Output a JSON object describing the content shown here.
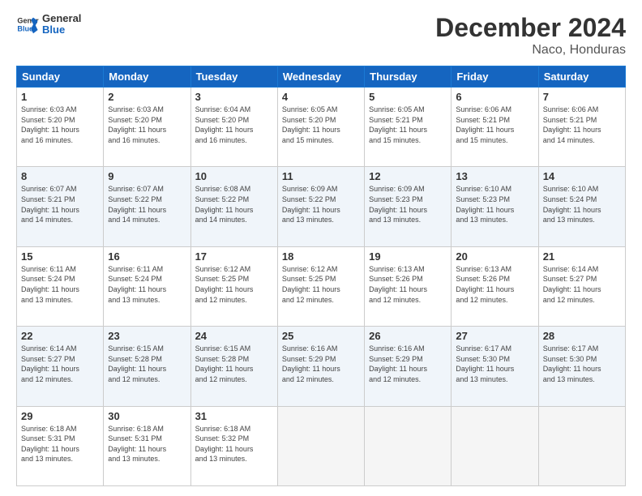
{
  "logo": {
    "line1": "General",
    "line2": "Blue"
  },
  "title": "December 2024",
  "subtitle": "Naco, Honduras",
  "calendar": {
    "headers": [
      "Sunday",
      "Monday",
      "Tuesday",
      "Wednesday",
      "Thursday",
      "Friday",
      "Saturday"
    ],
    "weeks": [
      [
        {
          "day": 1,
          "sunrise": "6:03 AM",
          "sunset": "5:20 PM",
          "daylight": "11 hours and 16 minutes."
        },
        {
          "day": 2,
          "sunrise": "6:03 AM",
          "sunset": "5:20 PM",
          "daylight": "11 hours and 16 minutes."
        },
        {
          "day": 3,
          "sunrise": "6:04 AM",
          "sunset": "5:20 PM",
          "daylight": "11 hours and 16 minutes."
        },
        {
          "day": 4,
          "sunrise": "6:05 AM",
          "sunset": "5:20 PM",
          "daylight": "11 hours and 15 minutes."
        },
        {
          "day": 5,
          "sunrise": "6:05 AM",
          "sunset": "5:21 PM",
          "daylight": "11 hours and 15 minutes."
        },
        {
          "day": 6,
          "sunrise": "6:06 AM",
          "sunset": "5:21 PM",
          "daylight": "11 hours and 15 minutes."
        },
        {
          "day": 7,
          "sunrise": "6:06 AM",
          "sunset": "5:21 PM",
          "daylight": "11 hours and 14 minutes."
        }
      ],
      [
        {
          "day": 8,
          "sunrise": "6:07 AM",
          "sunset": "5:21 PM",
          "daylight": "11 hours and 14 minutes."
        },
        {
          "day": 9,
          "sunrise": "6:07 AM",
          "sunset": "5:22 PM",
          "daylight": "11 hours and 14 minutes."
        },
        {
          "day": 10,
          "sunrise": "6:08 AM",
          "sunset": "5:22 PM",
          "daylight": "11 hours and 14 minutes."
        },
        {
          "day": 11,
          "sunrise": "6:09 AM",
          "sunset": "5:22 PM",
          "daylight": "11 hours and 13 minutes."
        },
        {
          "day": 12,
          "sunrise": "6:09 AM",
          "sunset": "5:23 PM",
          "daylight": "11 hours and 13 minutes."
        },
        {
          "day": 13,
          "sunrise": "6:10 AM",
          "sunset": "5:23 PM",
          "daylight": "11 hours and 13 minutes."
        },
        {
          "day": 14,
          "sunrise": "6:10 AM",
          "sunset": "5:24 PM",
          "daylight": "11 hours and 13 minutes."
        }
      ],
      [
        {
          "day": 15,
          "sunrise": "6:11 AM",
          "sunset": "5:24 PM",
          "daylight": "11 hours and 13 minutes."
        },
        {
          "day": 16,
          "sunrise": "6:11 AM",
          "sunset": "5:24 PM",
          "daylight": "11 hours and 13 minutes."
        },
        {
          "day": 17,
          "sunrise": "6:12 AM",
          "sunset": "5:25 PM",
          "daylight": "11 hours and 12 minutes."
        },
        {
          "day": 18,
          "sunrise": "6:12 AM",
          "sunset": "5:25 PM",
          "daylight": "11 hours and 12 minutes."
        },
        {
          "day": 19,
          "sunrise": "6:13 AM",
          "sunset": "5:26 PM",
          "daylight": "11 hours and 12 minutes."
        },
        {
          "day": 20,
          "sunrise": "6:13 AM",
          "sunset": "5:26 PM",
          "daylight": "11 hours and 12 minutes."
        },
        {
          "day": 21,
          "sunrise": "6:14 AM",
          "sunset": "5:27 PM",
          "daylight": "11 hours and 12 minutes."
        }
      ],
      [
        {
          "day": 22,
          "sunrise": "6:14 AM",
          "sunset": "5:27 PM",
          "daylight": "11 hours and 12 minutes."
        },
        {
          "day": 23,
          "sunrise": "6:15 AM",
          "sunset": "5:28 PM",
          "daylight": "11 hours and 12 minutes."
        },
        {
          "day": 24,
          "sunrise": "6:15 AM",
          "sunset": "5:28 PM",
          "daylight": "11 hours and 12 minutes."
        },
        {
          "day": 25,
          "sunrise": "6:16 AM",
          "sunset": "5:29 PM",
          "daylight": "11 hours and 12 minutes."
        },
        {
          "day": 26,
          "sunrise": "6:16 AM",
          "sunset": "5:29 PM",
          "daylight": "11 hours and 12 minutes."
        },
        {
          "day": 27,
          "sunrise": "6:17 AM",
          "sunset": "5:30 PM",
          "daylight": "11 hours and 13 minutes."
        },
        {
          "day": 28,
          "sunrise": "6:17 AM",
          "sunset": "5:30 PM",
          "daylight": "11 hours and 13 minutes."
        }
      ],
      [
        {
          "day": 29,
          "sunrise": "6:18 AM",
          "sunset": "5:31 PM",
          "daylight": "11 hours and 13 minutes."
        },
        {
          "day": 30,
          "sunrise": "6:18 AM",
          "sunset": "5:31 PM",
          "daylight": "11 hours and 13 minutes."
        },
        {
          "day": 31,
          "sunrise": "6:18 AM",
          "sunset": "5:32 PM",
          "daylight": "11 hours and 13 minutes."
        },
        null,
        null,
        null,
        null
      ]
    ]
  }
}
